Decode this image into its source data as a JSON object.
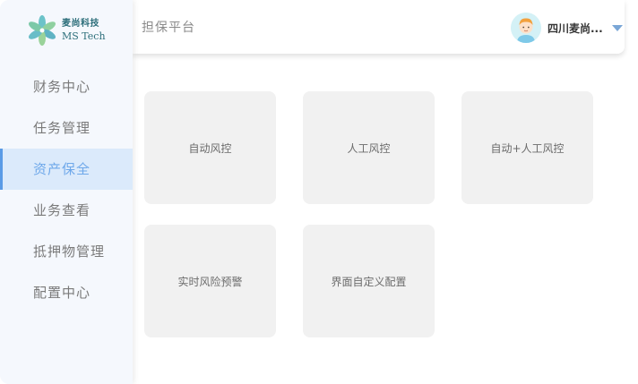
{
  "brand": {
    "name_cn": "麦尚科技",
    "name_en": "MS Tech",
    "logo_icon": "leaf-cluster-icon",
    "color": "#2c6e7a"
  },
  "header": {
    "title": "担保平台",
    "user_name": "四川麦尚...",
    "avatar_icon": "user-avatar-icon",
    "dropdown_icon": "caret-down-icon"
  },
  "sidebar": {
    "items": [
      {
        "label": "财务中心",
        "active": false
      },
      {
        "label": "任务管理",
        "active": false
      },
      {
        "label": "资产保全",
        "active": true
      },
      {
        "label": "业务查看",
        "active": false
      },
      {
        "label": "抵押物管理",
        "active": false
      },
      {
        "label": "配置中心",
        "active": false
      }
    ]
  },
  "main": {
    "cards": [
      {
        "label": "自动风控"
      },
      {
        "label": "人工风控"
      },
      {
        "label": "自动+人工风控"
      },
      {
        "label": "实时风险预警"
      },
      {
        "label": "界面自定义配置"
      }
    ]
  },
  "colors": {
    "accent": "#5a9be6",
    "active_bg": "#dbeafb",
    "card_bg": "#f1f1f1",
    "sidebar_bg": "#f5f8fd"
  }
}
